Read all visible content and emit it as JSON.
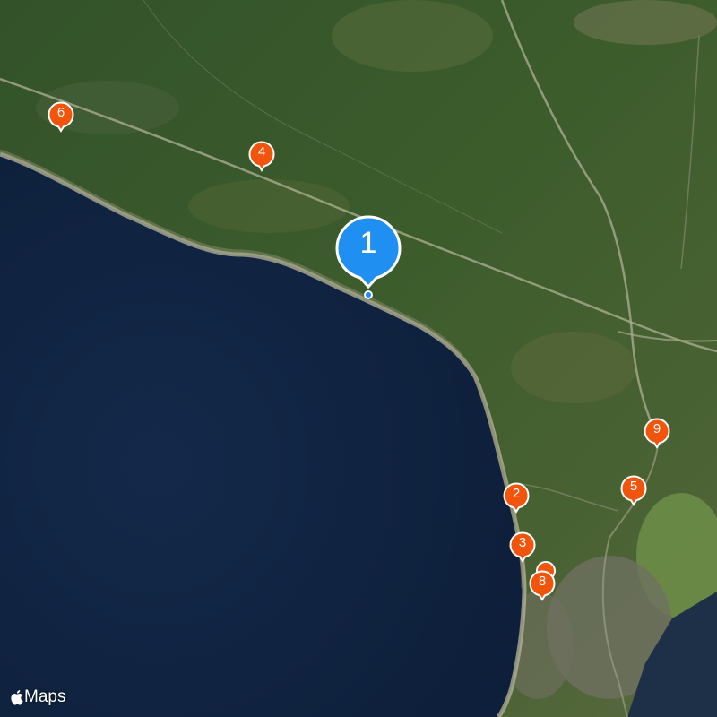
{
  "map": {
    "attribution": {
      "brand": "Maps",
      "icon": "apple-logo-icon"
    },
    "colors": {
      "pin_orange": "#f2540c",
      "pin_blue": "#1f8ff2",
      "sea": "#0f2340",
      "land": "#3a5a2c"
    },
    "pins": [
      {
        "id": "pin-1",
        "label": "1",
        "style": "selected"
      },
      {
        "id": "pin-2",
        "label": "2",
        "style": "small"
      },
      {
        "id": "pin-3",
        "label": "3",
        "style": "small"
      },
      {
        "id": "pin-4",
        "label": "4",
        "style": "small"
      },
      {
        "id": "pin-5",
        "label": "5",
        "style": "small"
      },
      {
        "id": "pin-6",
        "label": "6",
        "style": "small"
      },
      {
        "id": "pin-8",
        "label": "8",
        "style": "small"
      },
      {
        "id": "pin-9",
        "label": "9",
        "style": "small"
      }
    ]
  }
}
